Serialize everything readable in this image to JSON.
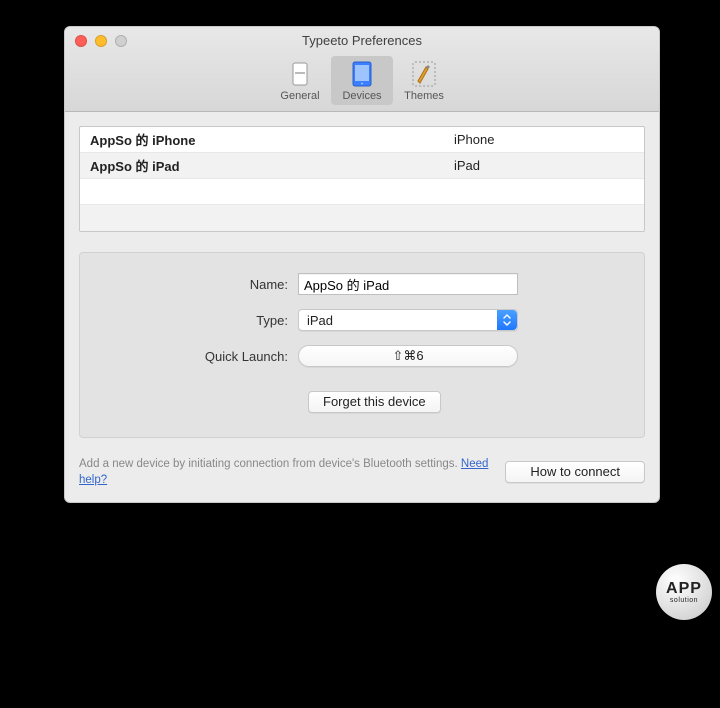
{
  "window": {
    "title": "Typeeto Preferences"
  },
  "toolbar": {
    "general": "General",
    "devices": "Devices",
    "themes": "Themes"
  },
  "devices": [
    {
      "name": "AppSo 的 iPhone",
      "type": "iPhone"
    },
    {
      "name": "AppSo 的 iPad",
      "type": "iPad"
    }
  ],
  "form": {
    "name_label": "Name:",
    "name_value": "AppSo 的 iPad",
    "type_label": "Type:",
    "type_value": "iPad",
    "quicklaunch_label": "Quick Launch:",
    "quicklaunch_value": "⇧⌘6",
    "forget_label": "Forget this device"
  },
  "footer": {
    "hint": "Add a new device by initiating connection from device's Bluetooth settings. ",
    "help_link": "Need help?",
    "how_to": "How to connect"
  },
  "watermark": {
    "line1": "APP",
    "line2": "solution"
  }
}
